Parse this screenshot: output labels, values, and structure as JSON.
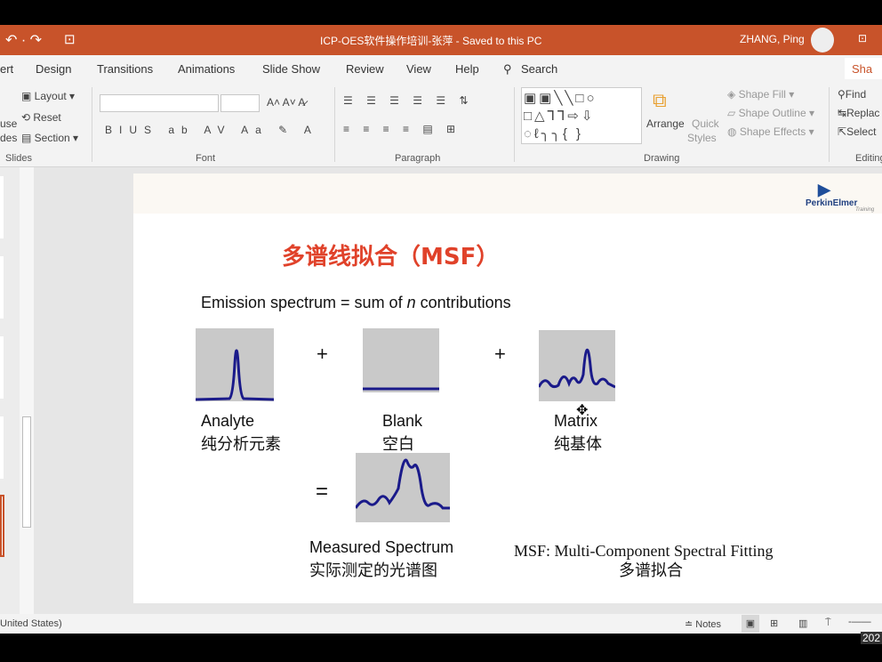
{
  "titlebar": {
    "title": "ICP-OES软件操作培训-张萍  -  Saved to this PC",
    "user": "ZHANG, Ping"
  },
  "tabs": [
    "ert",
    "Design",
    "Transitions",
    "Animations",
    "Slide Show",
    "Review",
    "View",
    "Help",
    "Search",
    "Sha"
  ],
  "ribbon": {
    "slides": {
      "layout": "Layout",
      "reset": "Reset",
      "section": "Section",
      "new1": "use",
      "new2": "des",
      "label": "Slides"
    },
    "font_label": "Font",
    "paragraph_label": "Paragraph",
    "drawing": {
      "arrange": "Arrange",
      "quick": "Quick",
      "styles": "Styles",
      "fill": "Shape Fill",
      "outline": "Shape Outline",
      "effects": "Shape Effects",
      "label": "Drawing"
    },
    "editing": {
      "find": "Find",
      "replace": "Replac",
      "select": "Select",
      "label": "Editing"
    }
  },
  "slide": {
    "title": "多谱线拟合（MSF）",
    "subtitle_pre": "Emission spectrum = sum of ",
    "subtitle_n": "n",
    "subtitle_post": " contributions",
    "logo": "PerkinElmer",
    "logo_sub": "Training",
    "plus": "+",
    "equals": "=",
    "analyte": "Analyte",
    "analyte_cn": "纯分析元素",
    "blank": "Blank",
    "blank_cn": "空白",
    "matrix": "Matrix",
    "matrix_cn": "纯基体",
    "measured": "Measured Spectrum",
    "measured_cn": "实际测定的光谱图",
    "msf": "MSF: Multi-Component Spectral Fitting",
    "msf_cn": "多谱拟合"
  },
  "status": {
    "lang": "United States)",
    "notes": "Notes",
    "clock": "202"
  }
}
